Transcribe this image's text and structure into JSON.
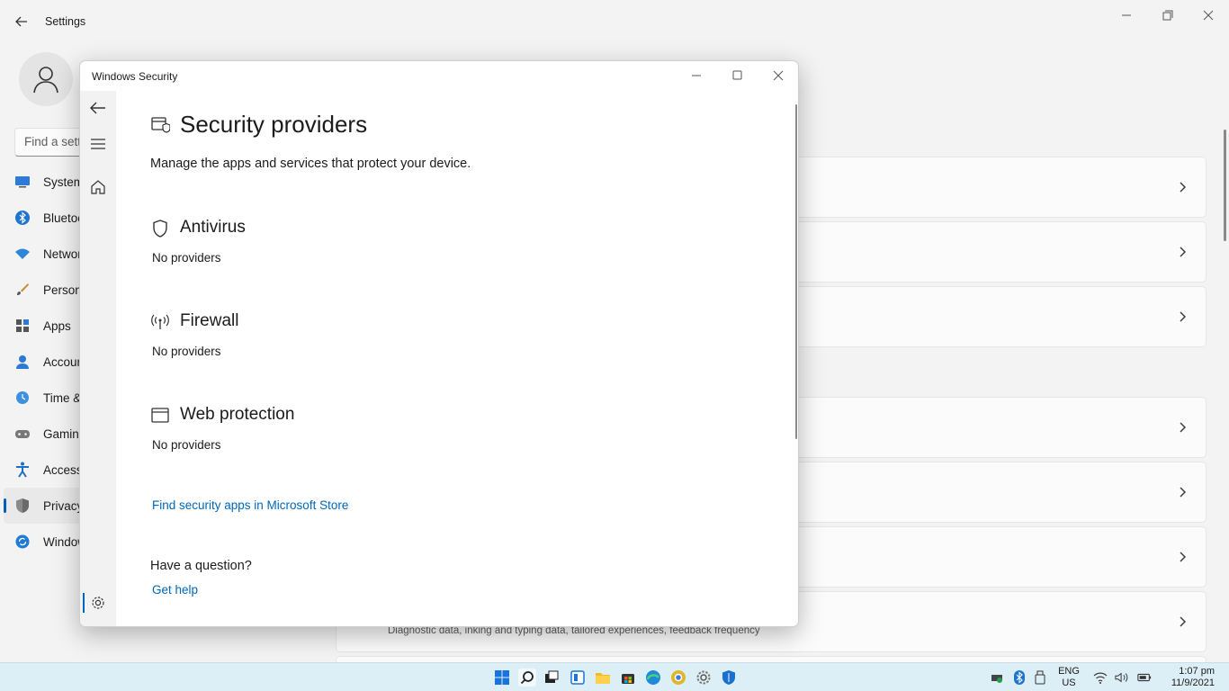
{
  "settings": {
    "title": "Settings",
    "search_placeholder": "Find a setting",
    "nav": [
      {
        "label": "System",
        "icon": "monitor-icon"
      },
      {
        "label": "Bluetooth & devices",
        "icon": "bluetooth-icon"
      },
      {
        "label": "Network & internet",
        "icon": "wifi-icon"
      },
      {
        "label": "Personalization",
        "icon": "brush-icon"
      },
      {
        "label": "Apps",
        "icon": "apps-icon"
      },
      {
        "label": "Accounts",
        "icon": "person-icon"
      },
      {
        "label": "Time & language",
        "icon": "globe-clock-icon"
      },
      {
        "label": "Gaming",
        "icon": "gamepad-icon"
      },
      {
        "label": "Accessibility",
        "icon": "accessibility-icon"
      },
      {
        "label": "Privacy & security",
        "icon": "shield-icon",
        "active": true
      },
      {
        "label": "Windows Update",
        "icon": "update-icon"
      }
    ],
    "last_card_desc": "Diagnostic data, inking and typing data, tailored experiences, feedback frequency"
  },
  "security": {
    "window_title": "Windows Security",
    "page_title": "Security providers",
    "page_subtitle": "Manage the apps and services that protect your device.",
    "sections": [
      {
        "title": "Antivirus",
        "value": "No providers",
        "icon": "shield-icon"
      },
      {
        "title": "Firewall",
        "value": "No providers",
        "icon": "antenna-icon"
      },
      {
        "title": "Web protection",
        "value": "No providers",
        "icon": "browser-window-icon"
      }
    ],
    "store_link": "Find security apps in Microsoft Store",
    "question": "Have a question?",
    "help_link": "Get help"
  },
  "taskbar": {
    "lang_top": "ENG",
    "lang_bottom": "US",
    "time": "1:07 pm",
    "date": "11/9/2021"
  },
  "colors": {
    "accent": "#0067b8",
    "taskbar": "#dceff6"
  }
}
